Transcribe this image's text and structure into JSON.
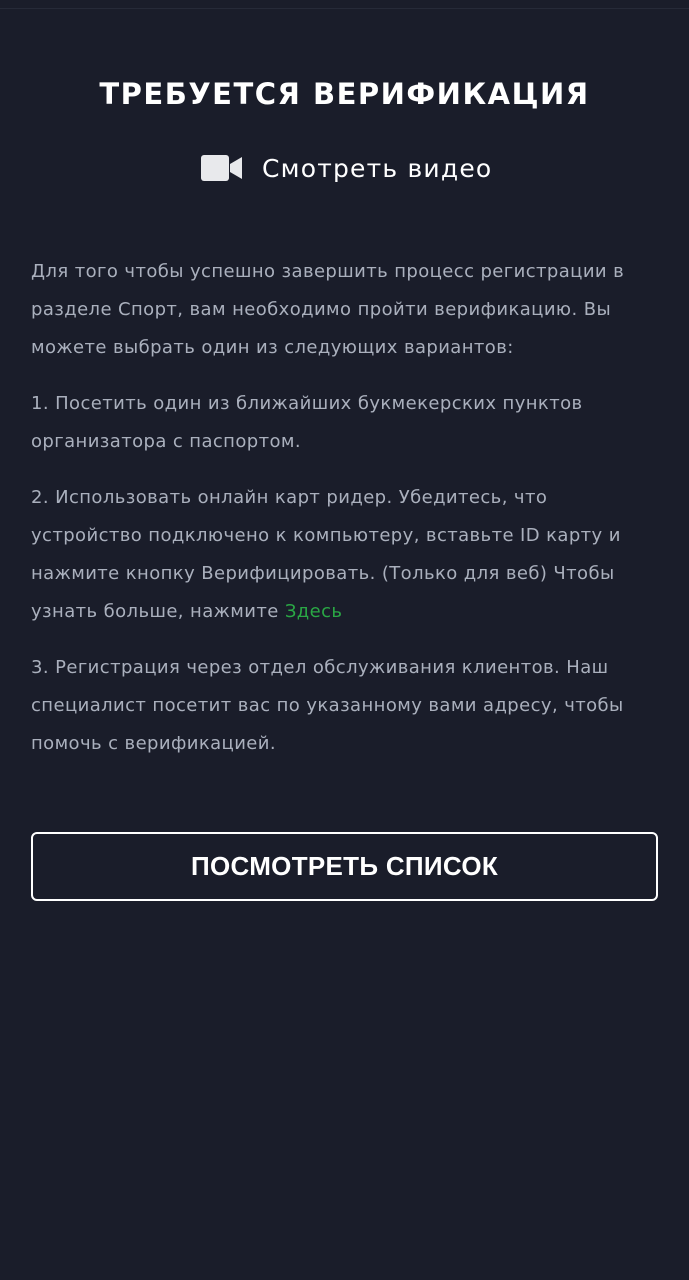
{
  "header": {
    "title": "ТРЕБУЕТСЯ ВЕРИФИКАЦИЯ"
  },
  "video": {
    "icon": "video-camera-icon",
    "label": "Смотреть видео"
  },
  "content": {
    "intro": "Для того чтобы успешно завершить процесс регистрации в разделе Спорт, вам необходимо пройти верификацию. Вы можете выбрать один из следующих вариантов:",
    "option1": "1. Посетить один из ближайших букмекерских пунктов организатора с паспортом.",
    "option2_text": "2. Использовать онлайн карт ридер. Убедитесь, что устройство подключено к компьютеру, вставьте ID карту и нажмите кнопку Верифицировать. (Только для веб) Чтобы узнать больше, нажмите ",
    "option2_link": "Здесь",
    "option3": "3. Регистрация через отдел обслуживания клиентов. Наш специалист посетит вас по указанному вами адресу, чтобы помочь с верификацией."
  },
  "actions": {
    "view_list_label": "ПОСМОТРЕТЬ СПИСОК"
  },
  "colors": {
    "background": "#1a1d2a",
    "text": "#aab0bd",
    "link": "#2aa845",
    "heading": "#ffffff"
  }
}
